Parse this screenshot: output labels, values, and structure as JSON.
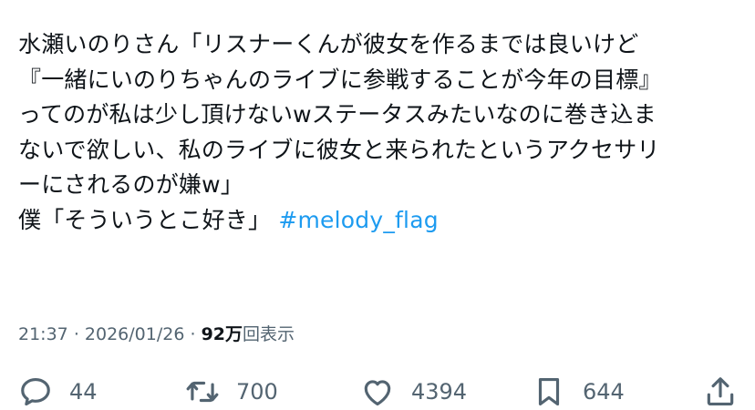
{
  "tweet": {
    "lines": [
      "水瀬いのりさん「リスナーくんが彼女を作るまでは良いけど",
      "『一緒にいのりちゃんのライブに参戦することが今年の目標』",
      "ってのが私は少し頂けないwステータスみたいなのに巻き込ま",
      "ないで欲しい、私のライブに彼女と来られたというアクセサリ",
      "ーにされるのが嫌w」"
    ],
    "last_line_text": "僕「そういうとこ好き」",
    "hashtag": "#melody_flag"
  },
  "meta": {
    "time": "21:37",
    "separator1": "·",
    "date": "2026/01/26",
    "separator2": "·",
    "views_count": "92万",
    "views_label": "回表示"
  },
  "actions": {
    "reply_count": "44",
    "retweet_count": "700",
    "like_count": "4394",
    "bookmark_count": "644"
  },
  "icons": {
    "reply": "reply-icon",
    "retweet": "retweet-icon",
    "like": "heart-icon",
    "bookmark": "bookmark-icon",
    "share": "share-icon"
  },
  "colors": {
    "text": "#0f1419",
    "secondary": "#536471",
    "hashtag": "#1d9bf0"
  }
}
